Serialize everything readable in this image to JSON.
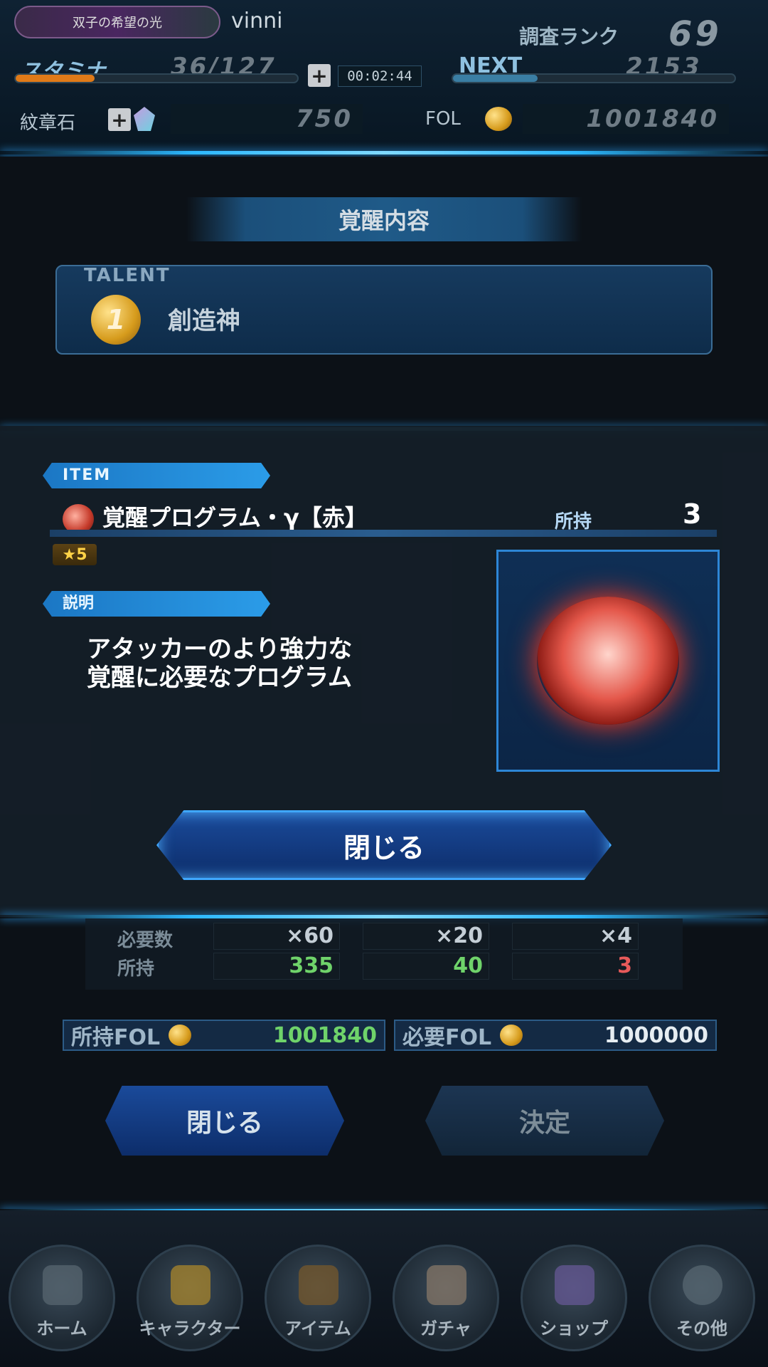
{
  "header": {
    "title_badge": "双子の希望の光",
    "username": "vinni",
    "rank_label": "調査ランク",
    "rank_value": "69",
    "stamina_label": "スタミナ",
    "stamina_value": "36/127",
    "stamina_progress": 0.28,
    "timer": "00:02:44",
    "next_label": "NEXT",
    "next_value": "2153",
    "next_progress": 0.3,
    "crest_label": "紋章石",
    "crest_value": "750",
    "fol_label": "FOL",
    "fol_value": "1001840"
  },
  "awakening": {
    "section_title": "覚醒内容",
    "talent_tag": "TALENT",
    "talent_number": "1",
    "talent_name": "創造神"
  },
  "modal": {
    "item_tag": "ITEM",
    "item_name": "覚醒プログラム・γ【赤】",
    "owned_label": "所持",
    "owned_value": "3",
    "rarity": "★5",
    "desc_tag": "説明",
    "desc_line1": "アタッカーのより強力な",
    "desc_line2": "覚醒に必要なプログラム",
    "close_label": "閉じる"
  },
  "requirements": {
    "needed_label": "必要数",
    "owned_label": "所持",
    "needed": [
      "×60",
      "×20",
      "×4"
    ],
    "owned": [
      "335",
      "40",
      "3"
    ],
    "owned_colors": [
      "#6fd36a",
      "#6fd36a",
      "#e85a5a"
    ]
  },
  "fol": {
    "owned_label": "所持FOL",
    "owned_value": "1001840",
    "required_label": "必要FOL",
    "required_value": "1000000"
  },
  "actions": {
    "close_label": "閉じる",
    "confirm_label": "決定"
  },
  "nav": {
    "items": [
      "ホーム",
      "キャラクター",
      "アイテム",
      "ガチャ",
      "ショップ",
      "その他"
    ]
  }
}
